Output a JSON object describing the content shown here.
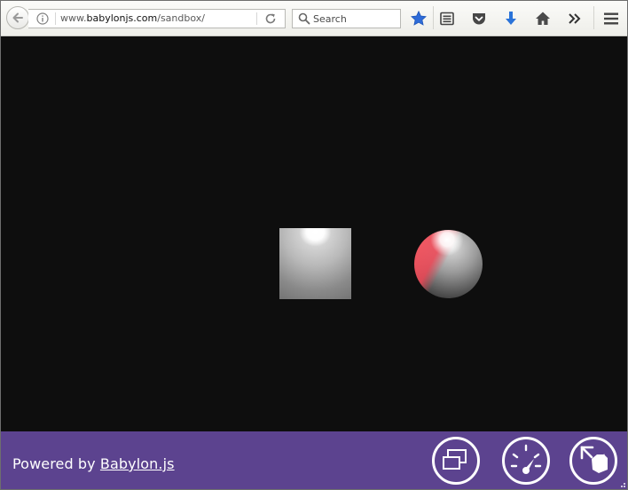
{
  "browser": {
    "url_prefix": "www.",
    "url_domain": "babylonjs.com",
    "url_path": "/sandbox/",
    "search_placeholder": "Search",
    "icons": [
      "back-arrow-icon",
      "info-icon",
      "reload-icon",
      "search-icon",
      "bookmark-star-icon",
      "reading-list-icon",
      "pocket-icon",
      "download-icon",
      "home-icon",
      "overflow-chevrons-icon",
      "hamburger-menu-icon"
    ],
    "colors": {
      "star": "#2e6bd8",
      "download": "#2a73d9"
    }
  },
  "footer": {
    "powered_text": "Powered by ",
    "link_text": "Babylon.js",
    "background": "#5c438f",
    "buttons": [
      "fullscreen-icon",
      "performance-gauge-icon",
      "open-file-icon"
    ]
  },
  "scene": {
    "background": "#0e0e0e",
    "objects": [
      "box",
      "sphere"
    ]
  }
}
